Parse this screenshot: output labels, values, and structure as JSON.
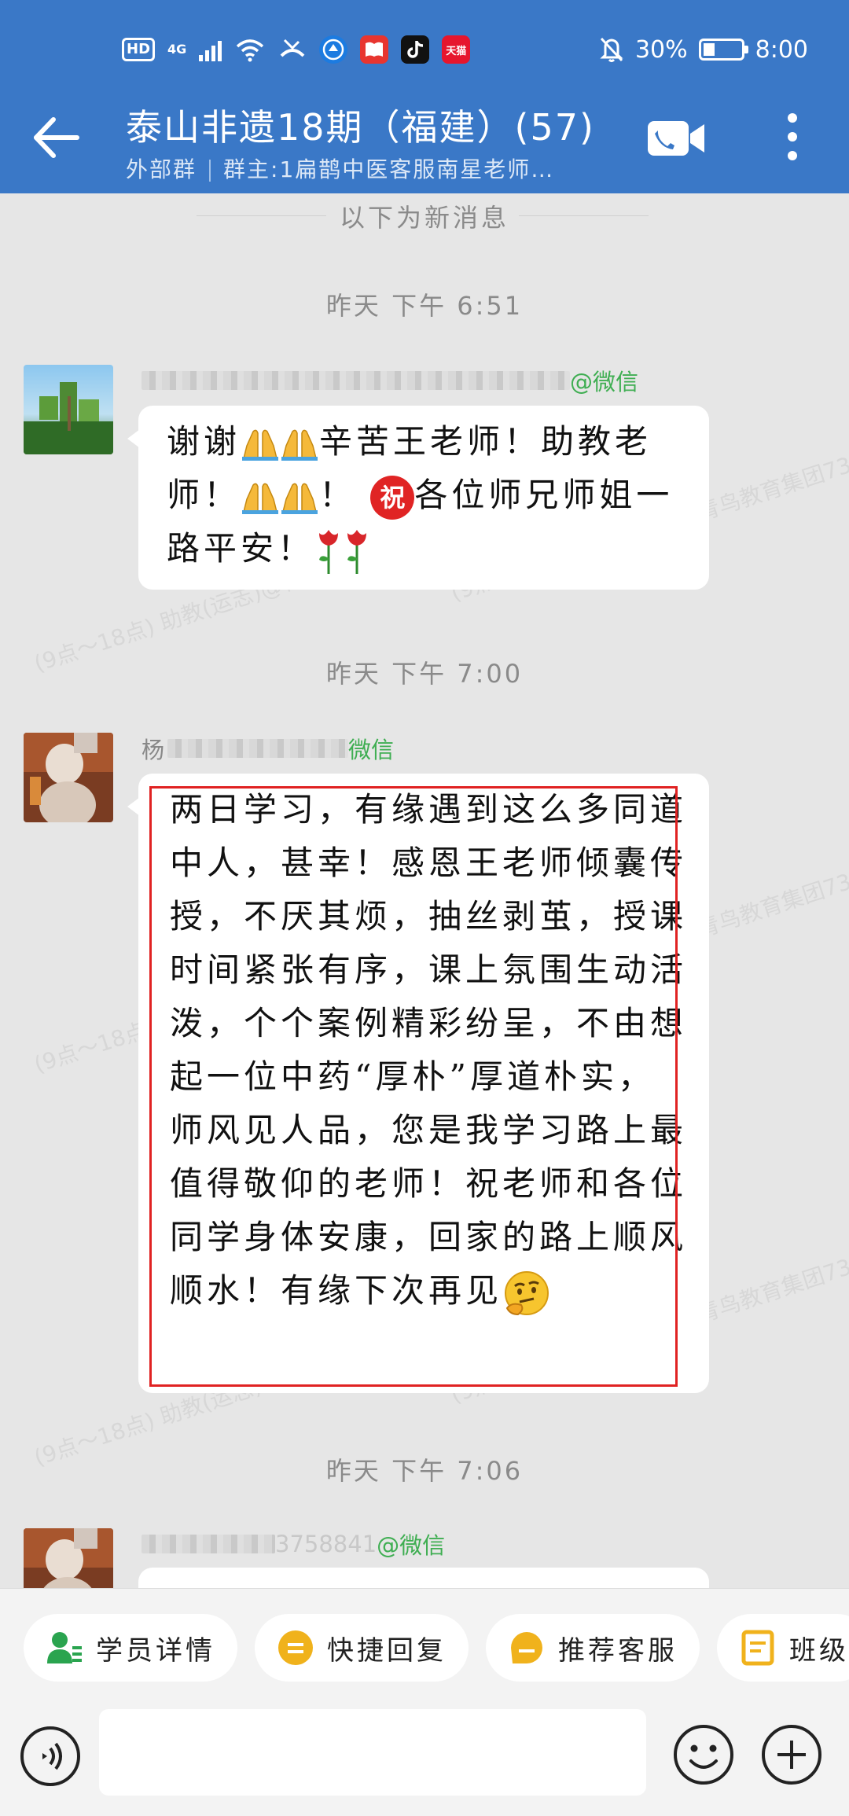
{
  "status_bar": {
    "hd": "HD",
    "network": "4G",
    "battery_text": "30%",
    "battery_level": 0.3,
    "time": "8:00",
    "app_icons": [
      "browser-icon",
      "reader-icon",
      "tiktok-icon",
      "tmall-icon"
    ],
    "tmall_label": "天猫"
  },
  "header": {
    "title": "泰山非遗18期（福建）(57)",
    "group_type": "外部群",
    "owner": "群主:1扁鹊中医客服南星老师…"
  },
  "chat": {
    "new_messages_divider": "以下为新消息",
    "watermark": "(9点～18点) 助教(运志)@青鸟教育集团7327",
    "messages": [
      {
        "time": "昨天  下午 6:51",
        "sender_suffix": "@微信",
        "text_1": "谢谢",
        "text_2": "辛苦王老师！助教老师！",
        "text_3": "！",
        "zhu": "祝",
        "text_4": "各位师兄师姐一路平安！"
      },
      {
        "time": "昨天  下午 7:00",
        "sender_prefix": "杨",
        "sender_suffix": "微信",
        "text": "两日学习，有缘遇到这么多同道中人，甚幸！感恩王老师倾囊传授，不厌其烦，抽丝剥茧，授课时间紧张有序，课上氛围生动活泼，个个案例精彩纷呈，不由想起一位中药“厚朴”厚道朴实，师风见人品，您是我学习路上最值得敬仰的老师！祝老师和各位同学身体安康，回家的路上顺风顺水！有缘下次再见"
      },
      {
        "time": "昨天  下午 7:06",
        "sender_visible": "3758841",
        "sender_suffix": "@微信"
      }
    ]
  },
  "quick_actions": [
    {
      "label": "学员详情",
      "icon": "student-detail-icon",
      "color": "#2aa44f"
    },
    {
      "label": "快捷回复",
      "icon": "quick-reply-icon",
      "color": "#f0b21c"
    },
    {
      "label": "推荐客服",
      "icon": "recommend-service-icon",
      "color": "#f0b21c"
    },
    {
      "label": "班级",
      "icon": "class-icon",
      "color": "#f0b21c"
    }
  ],
  "input": {
    "placeholder": ""
  },
  "colors": {
    "header_bg": "#3a78c7",
    "chat_bg": "#e6e6e6",
    "wechat_green": "#3fae52",
    "highlight_red": "#e02222"
  }
}
